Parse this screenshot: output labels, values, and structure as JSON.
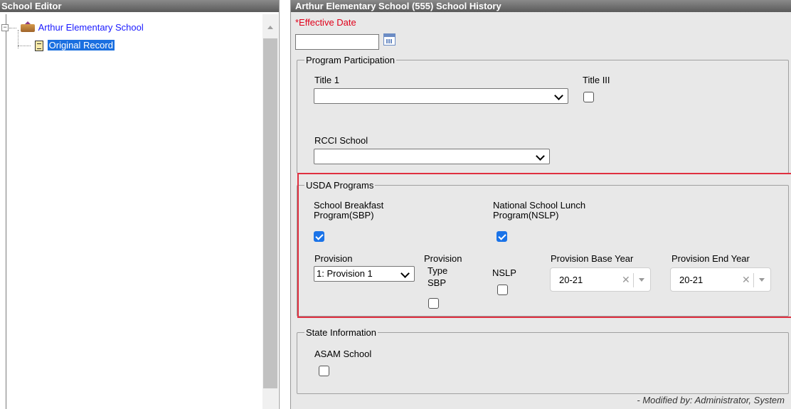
{
  "left_panel": {
    "title": "School Editor",
    "tree": {
      "school_name": "Arthur Elementary School",
      "record_label": "Original Record"
    }
  },
  "right_panel": {
    "title": "Arthur Elementary School (555) School History",
    "effective_date": {
      "label": "*Effective Date",
      "value": ""
    },
    "program_participation": {
      "legend": "Program Participation",
      "title1_label": "Title 1",
      "title1_value": "",
      "title3_label": "Title III",
      "title3_checked": false,
      "rcci_label": "RCCI School",
      "rcci_value": ""
    },
    "usda": {
      "legend": "USDA Programs",
      "sbp_label_line1": "School Breakfast",
      "sbp_label_line2": "Program(SBP)",
      "sbp_checked": true,
      "nslp_program_label_line1": "National School Lunch",
      "nslp_program_label_line2": "Program(NSLP)",
      "nslp_program_checked": true,
      "provision_label": "Provision",
      "provision_value": "1: Provision 1",
      "provision_type_sbp_line1": "Provision",
      "provision_type_sbp_line2": "Type",
      "provision_type_sbp_line3": "SBP",
      "provision_type_sbp_checked": false,
      "nslp_label": "NSLP",
      "nslp_checked": false,
      "base_year_label": "Provision Base Year",
      "base_year_value": "20-21",
      "end_year_label": "Provision End Year",
      "end_year_value": "20-21"
    },
    "state_information": {
      "legend": "State Information",
      "asam_label": "ASAM School",
      "asam_checked": false
    },
    "modified_by": "- Modified by: Administrator, System"
  },
  "colors": {
    "highlight_box": "#e03040",
    "checkbox_on": "#1a73e8",
    "required": "#e0001a",
    "link": "#1a1aff"
  }
}
